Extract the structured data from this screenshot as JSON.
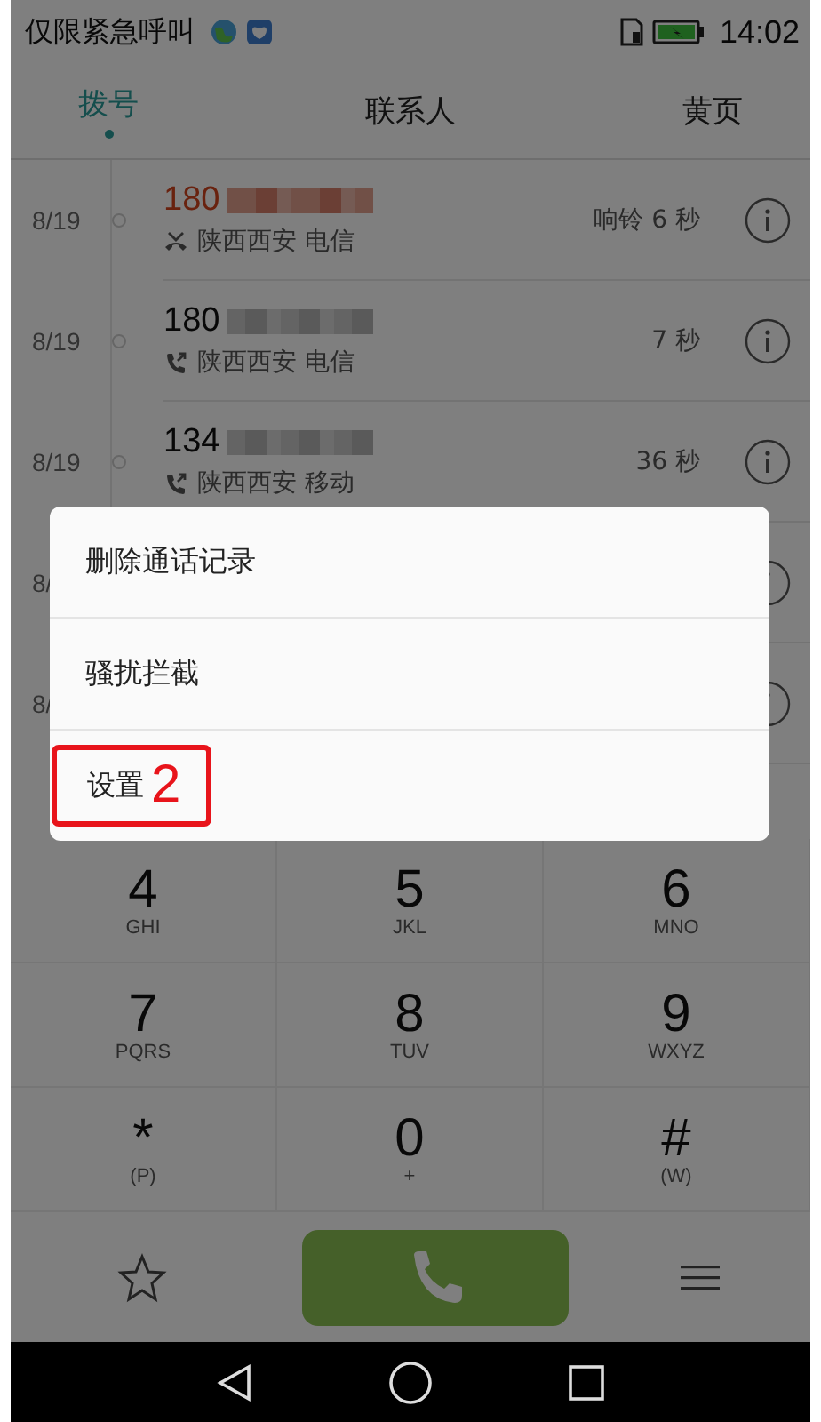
{
  "status_bar": {
    "carrier": "仅限紧急呼叫",
    "time": "14:02"
  },
  "tabs": [
    {
      "label": "拨号",
      "selected": true
    },
    {
      "label": "联系人",
      "selected": false
    },
    {
      "label": "黄页",
      "selected": false
    }
  ],
  "call_log": [
    {
      "date": "8/19",
      "number": "180",
      "kind": "missed",
      "location": "陕西西安 电信",
      "duration": "响铃 6 秒"
    },
    {
      "date": "8/19",
      "number": "180",
      "kind": "outgoing",
      "location": "陕西西安 电信",
      "duration": "7 秒"
    },
    {
      "date": "8/19",
      "number": "134",
      "kind": "outgoing",
      "location": "陕西西安 移动",
      "duration": "36 秒"
    },
    {
      "date": "8/"
    },
    {
      "date": "8/"
    }
  ],
  "menu": [
    {
      "label": "删除通话记录"
    },
    {
      "label": "骚扰拦截"
    },
    {
      "label": "设置",
      "annotation": "2"
    }
  ],
  "keypad": [
    {
      "digit": "4",
      "letters": "GHI"
    },
    {
      "digit": "5",
      "letters": "JKL"
    },
    {
      "digit": "6",
      "letters": "MNO"
    },
    {
      "digit": "7",
      "letters": "PQRS"
    },
    {
      "digit": "8",
      "letters": "TUV"
    },
    {
      "digit": "9",
      "letters": "WXYZ"
    },
    {
      "digit": "*",
      "letters": "(P)"
    },
    {
      "digit": "0",
      "letters": "+"
    },
    {
      "digit": "#",
      "letters": "(W)"
    }
  ]
}
